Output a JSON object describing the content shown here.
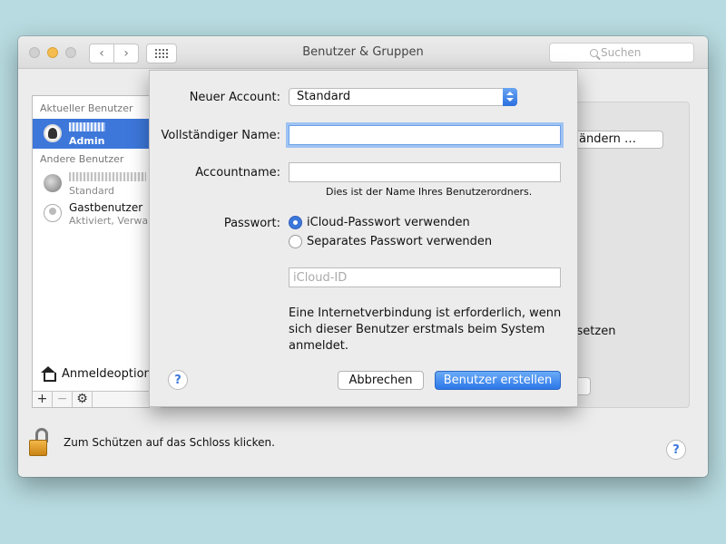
{
  "window": {
    "title": "Benutzer & Gruppen",
    "search_placeholder": "Suchen"
  },
  "sidebar": {
    "current_header": "Aktueller Benutzer",
    "other_header": "Andere Benutzer",
    "users": [
      {
        "name": "",
        "role": "Admin",
        "selected": true
      },
      {
        "name": "",
        "role": "Standard"
      },
      {
        "name": "Gastbenutzer",
        "role": "Aktiviert, Verwalt"
      }
    ],
    "login_options": "Anmeldeoption",
    "toolbar": {
      "add": "+",
      "remove": "−",
      "gear": "⚙"
    }
  },
  "background_pane": {
    "change_button": "ändern …",
    "reset_text": "ksetzen"
  },
  "lock": {
    "text": "Zum Schützen auf das Schloss klicken."
  },
  "sheet": {
    "account_label": "Neuer Account:",
    "account_value": "Standard",
    "fullname_label": "Vollständiger Name:",
    "fullname_value": "",
    "accountname_label": "Accountname:",
    "accountname_value": "",
    "accountname_hint": "Dies ist der Name Ihres Benutzerordners.",
    "password_label": "Passwort:",
    "radio_icloud": "iCloud-Passwort verwenden",
    "radio_separate": "Separates Passwort verwenden",
    "icloud_placeholder": "iCloud-ID",
    "info_text": "Eine Internetverbindung ist erforderlich, wenn sich dieser Benutzer erstmals beim System anmeldet.",
    "cancel_button": "Abbrechen",
    "create_button": "Benutzer erstellen",
    "help": "?"
  },
  "colors": {
    "accent": "#3d77da",
    "lock": "#f4b84c"
  }
}
